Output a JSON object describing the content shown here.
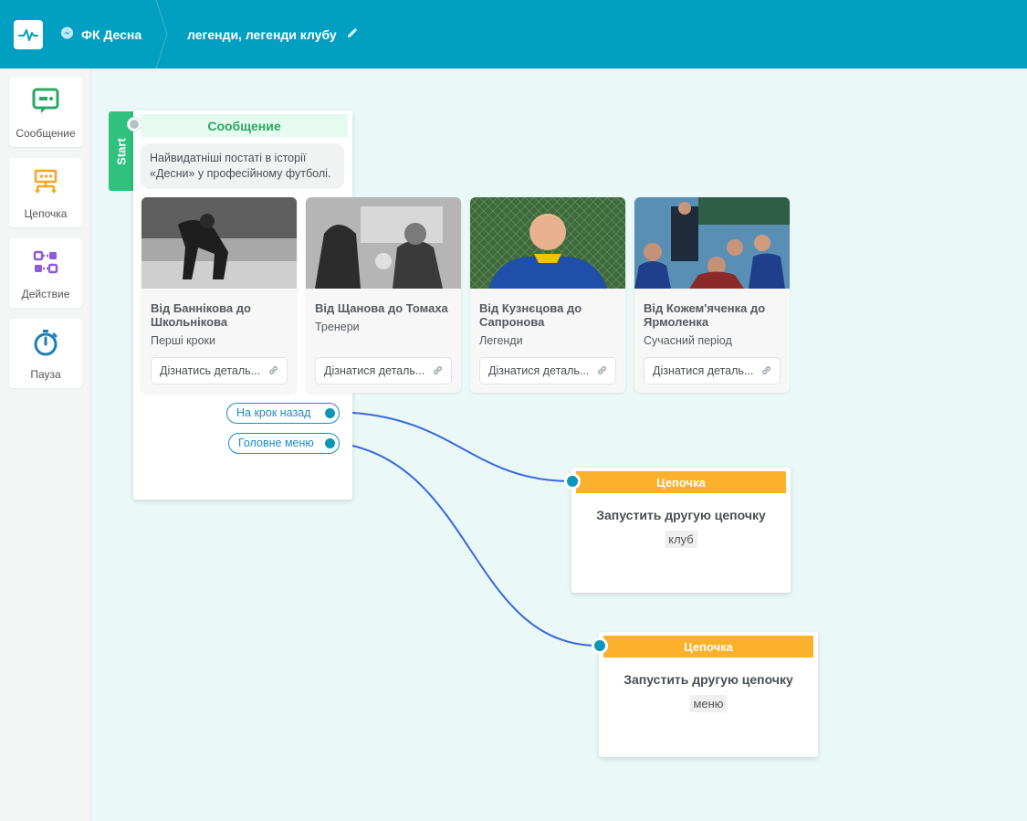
{
  "header": {
    "bot_name": "ФК Десна",
    "flow_name": "легенди, легенди клубу"
  },
  "sidebar": {
    "items": [
      {
        "label": "Сообщение",
        "icon": "message-icon",
        "color": "#2aa863"
      },
      {
        "label": "Цепочка",
        "icon": "chain-icon",
        "color": "#f5a623"
      },
      {
        "label": "Действие",
        "icon": "action-icon",
        "color": "#8e5cd9"
      },
      {
        "label": "Пауза",
        "icon": "timer-icon",
        "color": "#1b7fb5"
      }
    ]
  },
  "message_node": {
    "start_label": "Start",
    "title": "Сообщение",
    "text_line1": "Найвидатніші постаті в історії",
    "text_line2": "«Десни» у професійному футболі.",
    "cards": [
      {
        "title": "Від Баннікова до Школьнікова",
        "subtitle": "Перші кроки",
        "button": "Дізнатись деталь..."
      },
      {
        "title": "Від Щанова до Томаха",
        "subtitle": "Тренери",
        "button": "Дізнатися деталь..."
      },
      {
        "title": "Від Кузнєцова до Сапронова",
        "subtitle": "Легенди",
        "button": "Дізнатися деталь..."
      },
      {
        "title": "Від Кожем'яченка до Ярмоленка",
        "subtitle": "Сучасний період",
        "button": "Дізнатися деталь..."
      }
    ],
    "quick_replies": [
      "На крок назад",
      "Головне меню"
    ]
  },
  "chain_nodes": [
    {
      "title": "Цепочка",
      "text": "Запустить другую цепочку",
      "tag": "клуб"
    },
    {
      "title": "Цепочка",
      "text": "Запустить другую цепочку",
      "tag": "меню"
    }
  ],
  "colors": {
    "header": "#01a0c2",
    "canvas": "#eaf8f8",
    "start": "#2ec27e",
    "chain": "#fbb12b",
    "wire": "#3a66e0"
  }
}
